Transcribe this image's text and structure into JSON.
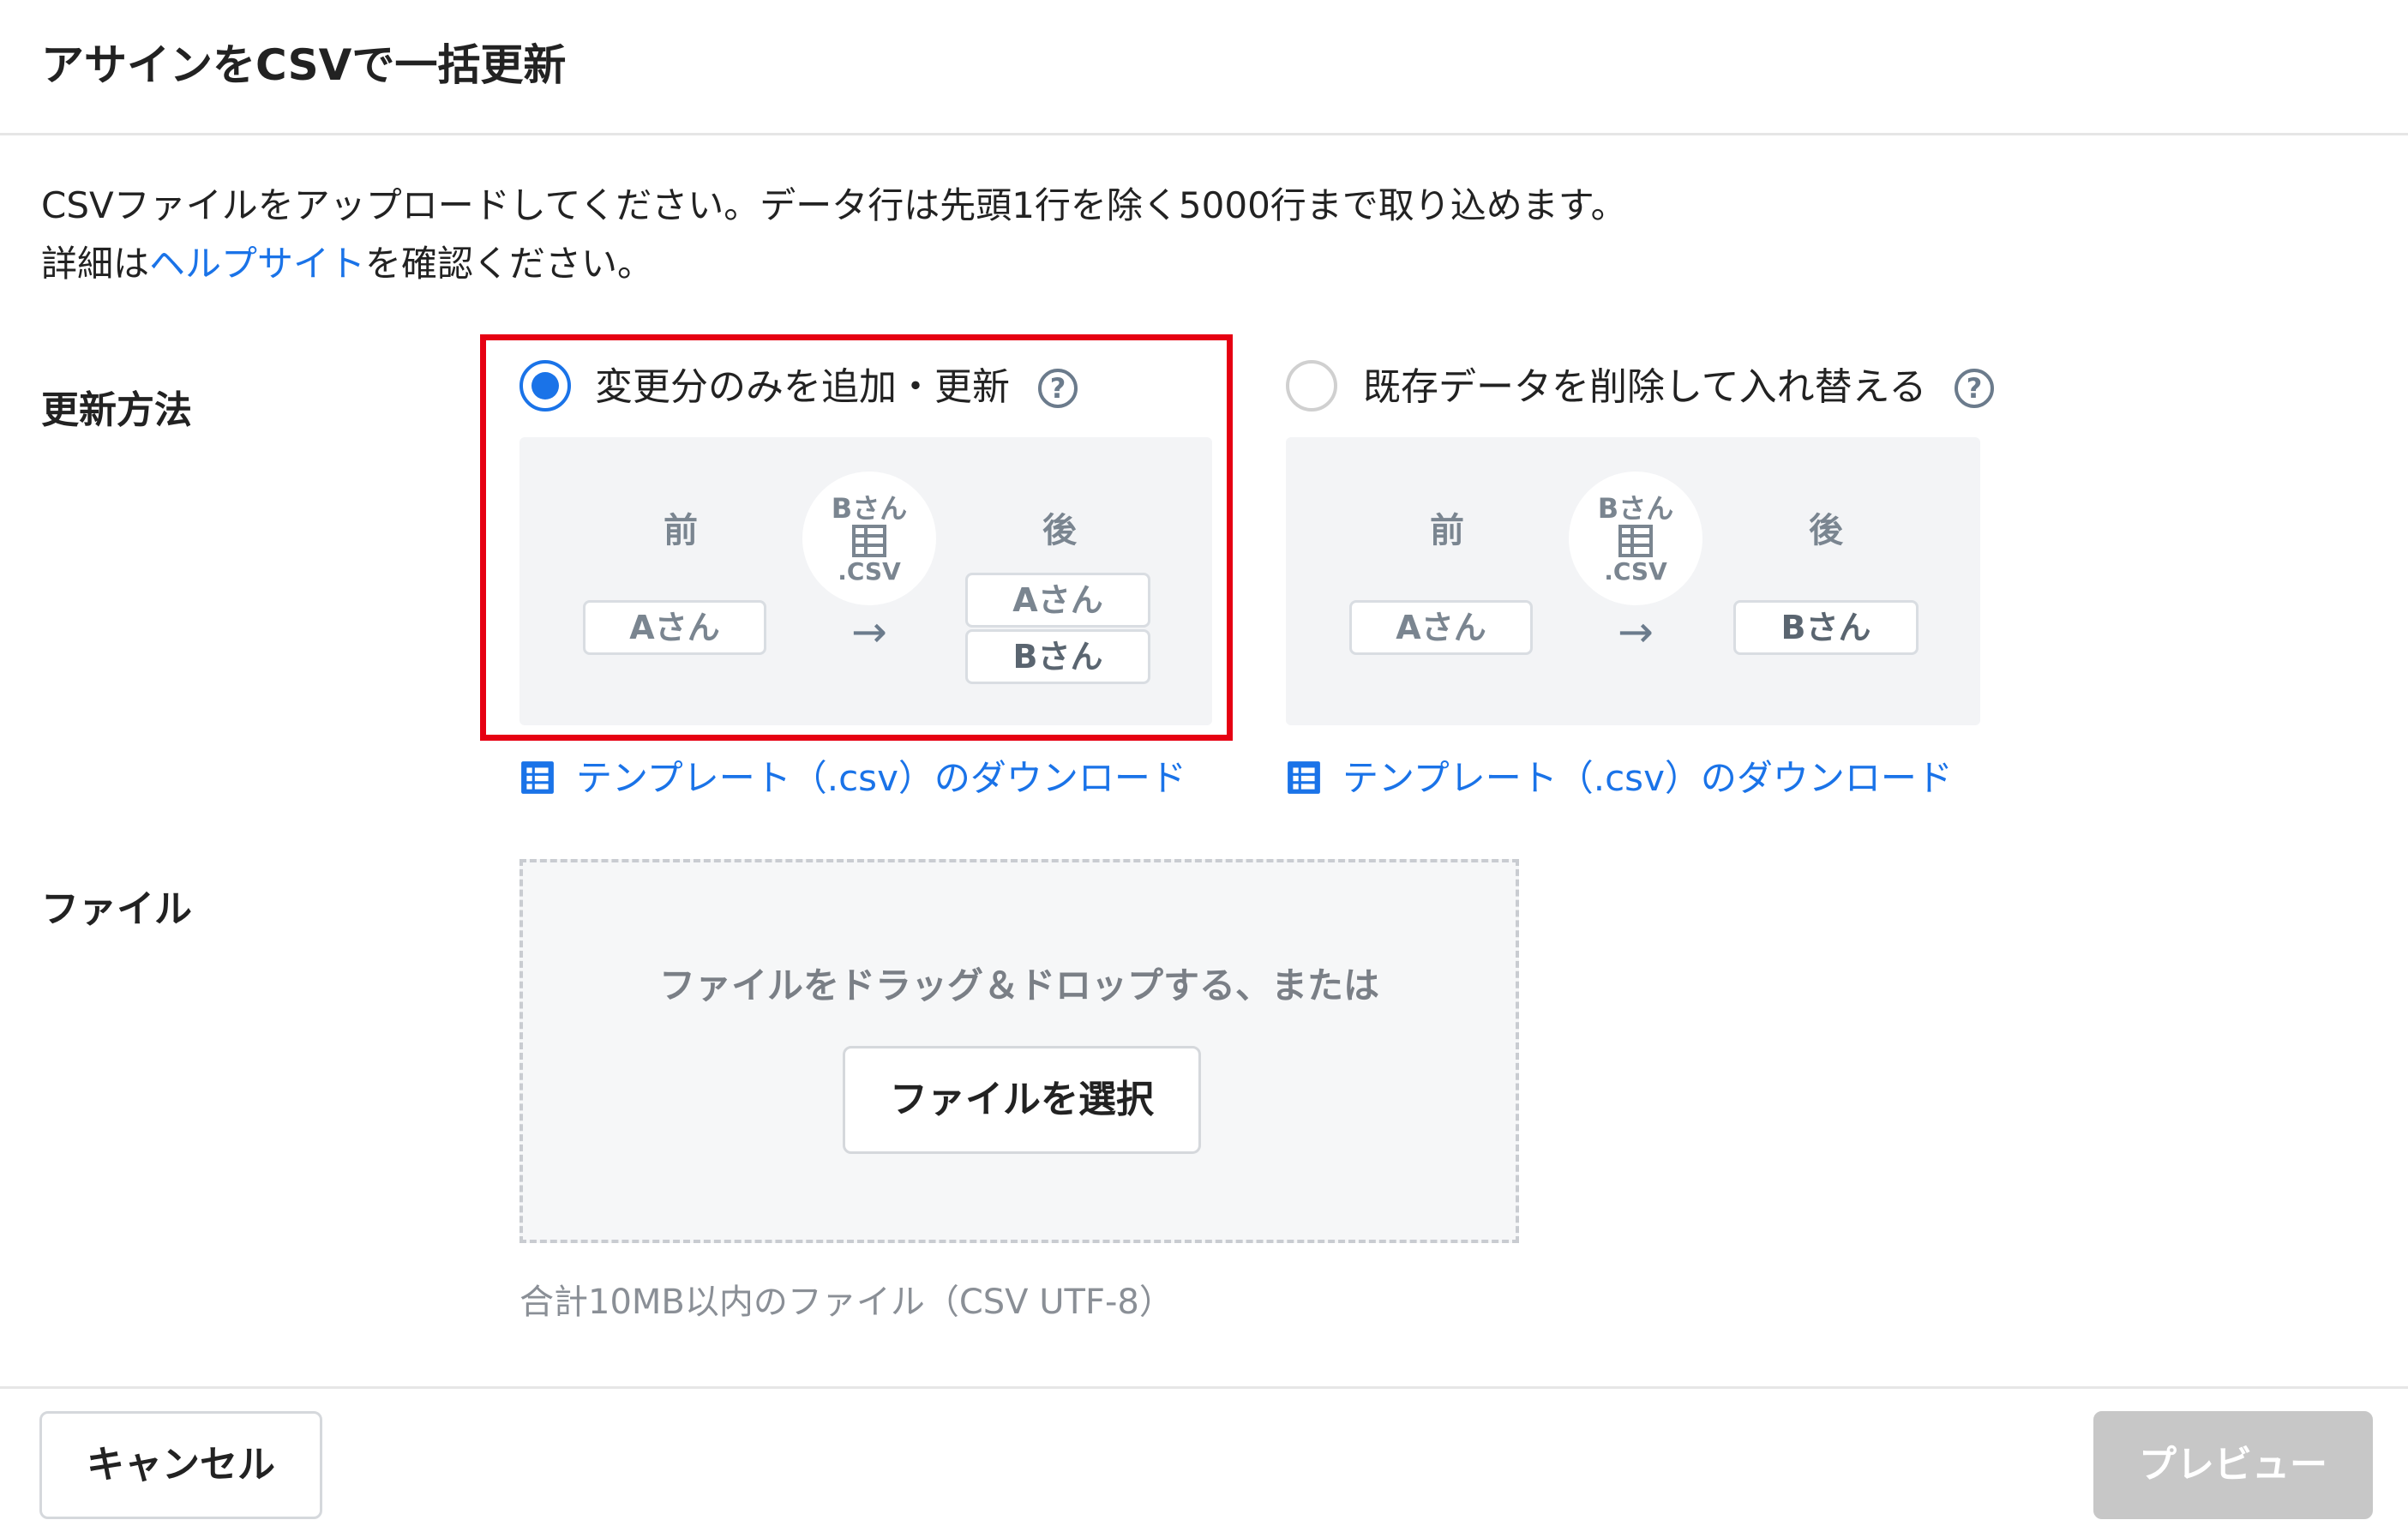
{
  "dialog": {
    "title": "アサインをCSVで一括更新"
  },
  "intro": {
    "line1": "CSVファイルをアップロードしてください。データ行は先頭1行を除く5000行まで取り込めます。",
    "line2_prefix": "詳細は",
    "line2_link": "ヘルプサイト",
    "line2_suffix": "を確認ください。"
  },
  "update_method": {
    "label": "更新方法",
    "options": [
      {
        "label": "変更分のみを追加・更新",
        "selected": true,
        "illustration": {
          "before_header": "前",
          "after_header": "後",
          "before_chips": [
            "Aさん"
          ],
          "file_name": "Bさん",
          "file_ext": ".CSV",
          "after_chips": [
            "Aさん",
            "Bさん"
          ]
        },
        "download_label": "テンプレート（.csv）のダウンロード"
      },
      {
        "label": "既存データを削除して入れ替える",
        "selected": false,
        "illustration": {
          "before_header": "前",
          "after_header": "後",
          "before_chips": [
            "Aさん"
          ],
          "file_name": "Bさん",
          "file_ext": ".CSV",
          "after_chips": [
            "Bさん"
          ]
        },
        "download_label": "テンプレート（.csv）のダウンロード"
      }
    ],
    "help_glyph": "?",
    "arrow_glyph": "→"
  },
  "file": {
    "label": "ファイル",
    "drop_text": "ファイルをドラッグ＆ドロップする、または",
    "select_button": "ファイルを選択",
    "note": "合計10MB以内のファイル（CSV UTF-8）"
  },
  "footer": {
    "cancel": "キャンセル",
    "preview": "プレビュー"
  },
  "colors": {
    "accent": "#1a73e8",
    "highlight": "#e60012",
    "panel": "#f3f4f6"
  }
}
